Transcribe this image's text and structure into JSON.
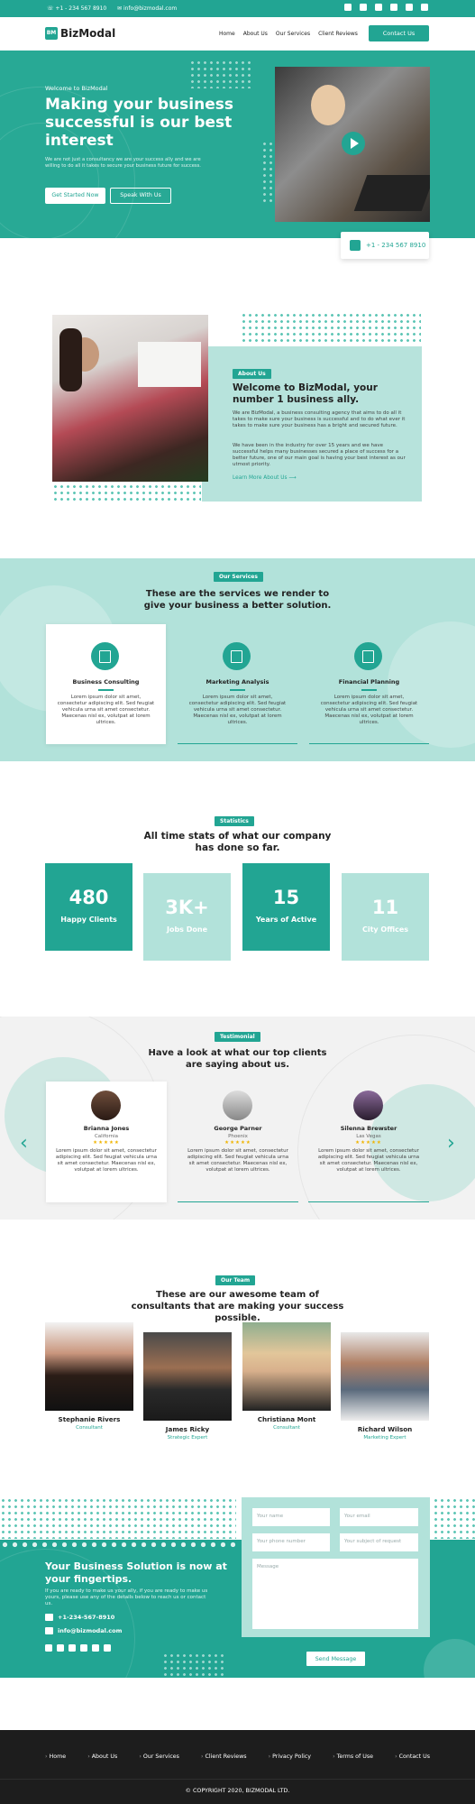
{
  "topbar": {
    "phone": "+1 - 234 567 8910",
    "email": "info@bizmodal.com",
    "social_icons": [
      "facebook-icon",
      "twitter-icon",
      "linkedin-icon",
      "instagram-icon",
      "youtube-icon",
      "whatsapp-icon"
    ]
  },
  "header": {
    "logo_mark": "BM",
    "logo_text": "BizModal",
    "nav": [
      "Home",
      "About Us",
      "Our Services",
      "Client Reviews"
    ],
    "cta": "Contact Us"
  },
  "hero": {
    "welcome": "Welcome to BizModal",
    "title": "Making your business successful is our best interest",
    "subtitle": "We are not just a consultancy we are your success ally and we are willing to do all it takes to secure your business future for success.",
    "btn_primary": "Get Started Now",
    "btn_secondary": "Speak With Us",
    "phone_card": "+1 - 234 567 8910"
  },
  "about": {
    "badge": "About Us",
    "title": "Welcome to BizModal, your number 1 business ally.",
    "para1": "We are BizModal, a business consulting agency that aims to do all it takes to make sure your business is successful and to do what ever it takes to make sure your business has a bright and secured future.",
    "para2": "We have been in the industry for over 15 years and we have successful helps many businesses secured a place of success for a better future, one of our main goal is having your best interest as our utmost priority.",
    "link": "Learn More About Us"
  },
  "services": {
    "badge": "Our Services",
    "title": "These are the services we render to give your business a better solution.",
    "items": [
      {
        "title": "Business Consulting",
        "desc": "Lorem ipsum dolor sit amet, consectetur adipiscing elit. Sed feugiat vehicula urna sit amet consectetur. Maecenas nisl ex, volutpat at lorem ultrices."
      },
      {
        "title": "Marketing Analysis",
        "desc": "Lorem ipsum dolor sit amet, consectetur adipiscing elit. Sed feugiat vehicula urna sit amet consectetur. Maecenas nisl ex, volutpat at lorem ultrices."
      },
      {
        "title": "Financial Planning",
        "desc": "Lorem ipsum dolor sit amet, consectetur adipiscing elit. Sed feugiat vehicula urna sit amet consectetur. Maecenas nisl ex, volutpat at lorem ultrices."
      }
    ]
  },
  "stats": {
    "badge": "Statistics",
    "title": "All time stats of what our company has done so far.",
    "items": [
      {
        "value": "480",
        "label": "Happy Clients"
      },
      {
        "value": "3K+",
        "label": "Jobs Done"
      },
      {
        "value": "15",
        "label": "Years of Active"
      },
      {
        "value": "11",
        "label": "City Offices"
      }
    ]
  },
  "testimonials": {
    "badge": "Testimonial",
    "title": "Have a look at what our top clients are saying about us.",
    "items": [
      {
        "name": "Brianna Jones",
        "location": "California",
        "stars": "★★★★★",
        "text": "Lorem ipsum dolor sit amet, consectetur adipiscing elit. Sed feugiat vehicula urna sit amet consectetur. Maecenas nisl ex, volutpat at lorem ultrices."
      },
      {
        "name": "George Parner",
        "location": "Phoenix",
        "stars": "★★★★★",
        "text": "Lorem ipsum dolor sit amet, consectetur adipiscing elit. Sed feugiat vehicula urna sit amet consectetur. Maecenas nisl ex, volutpat at lorem ultrices."
      },
      {
        "name": "Silenna Brewster",
        "location": "Las Vegas",
        "stars": "★★★★★",
        "text": "Lorem ipsum dolor sit amet, consectetur adipiscing elit. Sed feugiat vehicula urna sit amet consectetur. Maecenas nisl ex, volutpat at lorem ultrices."
      }
    ],
    "prev": "‹",
    "next": "›"
  },
  "team": {
    "badge": "Our Team",
    "title": "These are our awesome team of consultants that are making your success possible.",
    "members": [
      {
        "name": "Stephanie Rivers",
        "role": "Consultant"
      },
      {
        "name": "James Ricky",
        "role": "Strategic Expert"
      },
      {
        "name": "Christiana Mont",
        "role": "Consultant"
      },
      {
        "name": "Richard Wilson",
        "role": "Marketing Expert"
      }
    ]
  },
  "contact": {
    "title": "Your Business Solution is now at your fingertips.",
    "subtitle": "If you are ready to make us your ally, if you are ready to make us yours, please use any of the details below to reach us or contact us.",
    "phone": "+1-234-567-8910",
    "email": "info@bizmodal.com",
    "form": {
      "name_placeholder": "Your name",
      "email_placeholder": "Your email",
      "phone_placeholder": "Your phone number",
      "subject_placeholder": "Your subject of request",
      "message_placeholder": "Message",
      "send": "Send Message"
    }
  },
  "footer": {
    "links": [
      "Home",
      "About Us",
      "Our Services",
      "Client Reviews",
      "Privacy Policy",
      "Terms of Use",
      "Contact Us"
    ],
    "copyright": "© COPYRIGHT 2020, BIZMODAL LTD."
  },
  "colors": {
    "primary": "#22a593",
    "light": "#b2e2da",
    "dark": "#1d1d1d"
  }
}
